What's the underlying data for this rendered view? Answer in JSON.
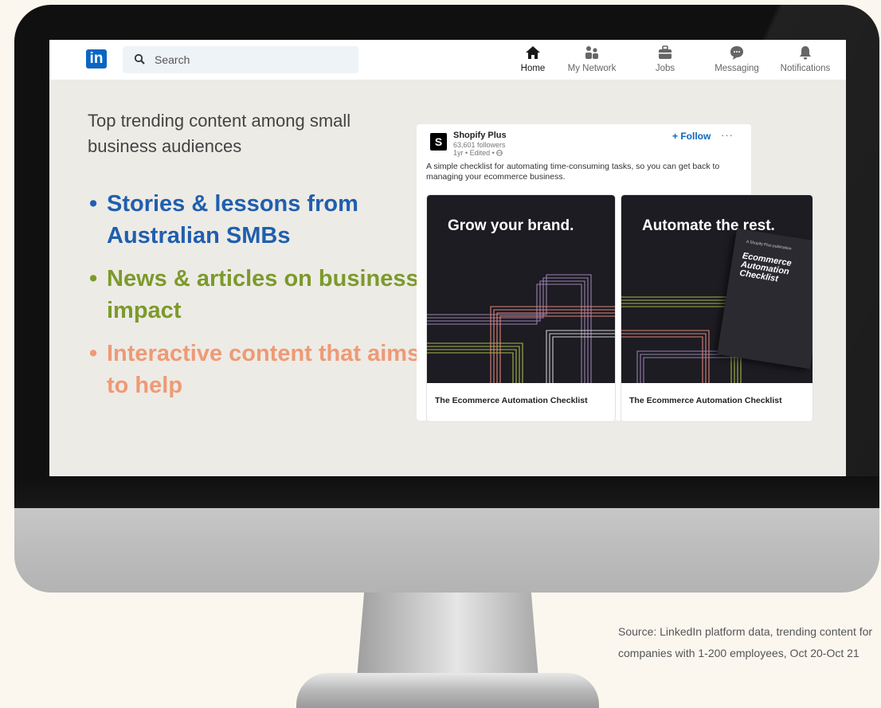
{
  "nav": {
    "logo_text": "in",
    "search_placeholder": "Search",
    "items": [
      {
        "label": "Home",
        "icon": "home-icon",
        "active": true
      },
      {
        "label": "My Network",
        "icon": "network-icon",
        "active": false
      },
      {
        "label": "Jobs",
        "icon": "briefcase-icon",
        "active": false
      },
      {
        "label": "Messaging",
        "icon": "message-icon",
        "active": false
      },
      {
        "label": "Notifications",
        "icon": "bell-icon",
        "active": false
      }
    ]
  },
  "copy": {
    "lead": "Top trending content among small business audiences",
    "bullets": [
      {
        "text": "Stories & lessons from Australian SMBs",
        "color": "#1f5fae"
      },
      {
        "text": "News & articles on business impact",
        "color": "#7c9a2b"
      },
      {
        "text": "Interactive content that aims to help",
        "color": "#ee9a75"
      }
    ]
  },
  "post": {
    "company": "Shopify Plus",
    "followers": "63,601 followers",
    "meta": "1yr • Edited •",
    "follow_label": "+ Follow",
    "more_label": "···",
    "text": "A simple checklist for automating time-consuming tasks, so you can get back to managing your ecommerce business.",
    "cards": [
      {
        "headline": "Grow your brand.",
        "caption": "The Ecommerce Automation Checklist"
      },
      {
        "headline": "Automate the rest.",
        "caption": "The Ecommerce Automation Checklist",
        "ebook_title": "Ecommerce Automation Checklist",
        "ebook_tag": "A Shopify Plus publication"
      }
    ]
  },
  "source": "Source: LinkedIn platform data, trending content for companies with 1-200 employees, Oct 20-Oct 21",
  "colors": {
    "linkedin_blue": "#0a66c2",
    "accent_blue": "#1f5fae",
    "accent_green": "#7c9a2b",
    "accent_peach": "#ee9a75"
  }
}
